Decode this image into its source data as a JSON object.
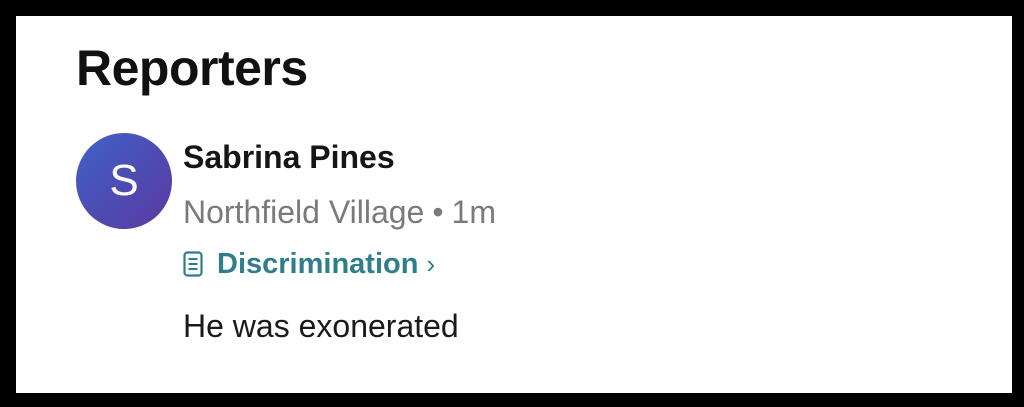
{
  "section": {
    "title": "Reporters"
  },
  "reporter": {
    "avatar_initial": "S",
    "name": "Sabrina Pines",
    "location": "Northfield Village",
    "separator": "•",
    "time_ago": "1m",
    "category": {
      "icon": "document-icon",
      "label": "Discrimination",
      "chevron": "›",
      "color": "#2f7e8c"
    },
    "comment": "He was exonerated"
  },
  "colors": {
    "background": "#ffffff",
    "frame": "#000000",
    "avatar_gradient_start": "#3f63c9",
    "avatar_gradient_end": "#5a3aa2",
    "meta_text": "#7a7a7a"
  }
}
